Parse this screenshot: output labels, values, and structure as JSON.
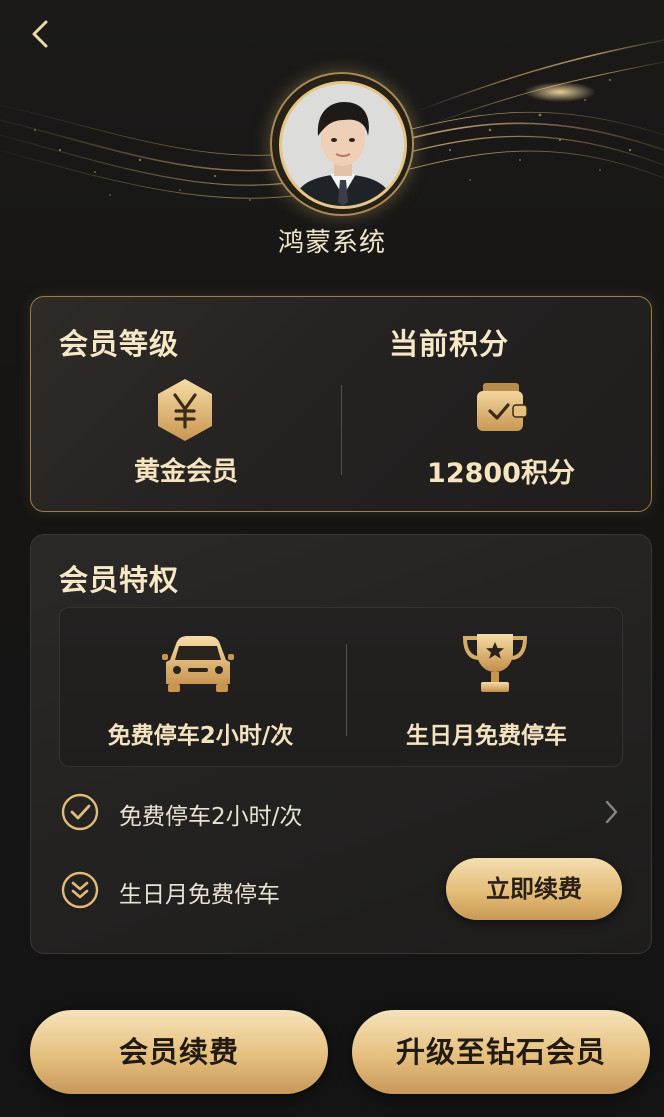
{
  "header": {
    "username": "鸿蒙系统"
  },
  "membership": {
    "level_title": "会员等级",
    "level_value": "黄金会员",
    "points_title": "当前积分",
    "points_value": "12800积分"
  },
  "privileges": {
    "title": "会员特权",
    "feature_cards": [
      {
        "label": "免费停车2小时/次",
        "icon": "car-icon"
      },
      {
        "label": "生日月免费停车",
        "icon": "trophy-icon"
      }
    ],
    "list_items": [
      {
        "label": "免费停车2小时/次",
        "icon": "check-circle-icon",
        "trailing": "chevron-right-icon"
      },
      {
        "label": "生日月免费停车",
        "icon": "double-chevron-down-circle-icon"
      }
    ],
    "renew_now_label": "立即续费"
  },
  "actions": {
    "renew_label": "会员续费",
    "upgrade_label": "升级至钻石会员"
  },
  "colors": {
    "gold": "#e5c07e",
    "gold_light": "#f6e3ba",
    "background": "#161514",
    "text_gold": "#f6e7c6"
  }
}
